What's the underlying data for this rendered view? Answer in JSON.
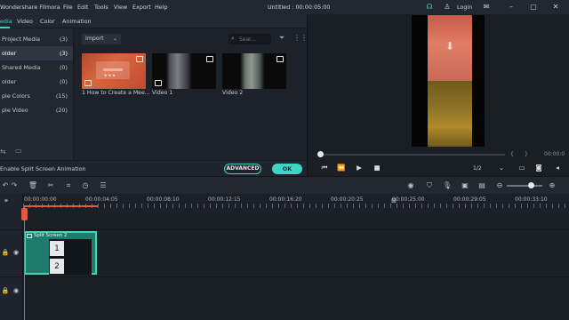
{
  "app": {
    "name": "Wondershare Filmora",
    "menu": [
      "File",
      "Edit",
      "Tools",
      "View",
      "Export",
      "Help"
    ],
    "project_title": "Untitled : 00:00:05:00",
    "login_label": "Login"
  },
  "tabs": [
    {
      "label": "edia",
      "active": true
    },
    {
      "label": "Video"
    },
    {
      "label": "Color"
    },
    {
      "label": "Animation"
    }
  ],
  "sidebar": {
    "items": [
      {
        "label": "Project Media",
        "count": "(3)"
      },
      {
        "label": "older",
        "count": "(3)",
        "active": true
      },
      {
        "label": "Shared Media",
        "count": "(0)"
      },
      {
        "label": "older",
        "count": "(0)"
      },
      {
        "label": "ple Colors",
        "count": "(15)"
      },
      {
        "label": "ple Video",
        "count": "(20)"
      }
    ]
  },
  "media": {
    "import_label": "Import",
    "search_placeholder": "Sear...",
    "clips": [
      {
        "label": "1 How to Create a Mee..."
      },
      {
        "label": "Video 1"
      },
      {
        "label": "Video 2"
      }
    ]
  },
  "preview": {
    "time": "00:00:0",
    "ratio": "1/2"
  },
  "split_option": {
    "label": "Enable Split Screen Animation",
    "advanced_label": "ADVANCED",
    "ok_label": "OK"
  },
  "timeline": {
    "ruler": [
      "00:00:00:00",
      "00:00:04:05",
      "00:00:08:10",
      "00:00:12:15",
      "00:00:16:20",
      "00:00:20:25",
      "00:00:25:00",
      "00:00:29:05",
      "00:00:33:10"
    ],
    "clip_title": "Split Screen 2",
    "cells": [
      "1",
      "2"
    ]
  },
  "colors": {
    "accent": "#3fd5c6",
    "playhead": "#e35b3e",
    "clip_fill": "#1f7c6d"
  }
}
